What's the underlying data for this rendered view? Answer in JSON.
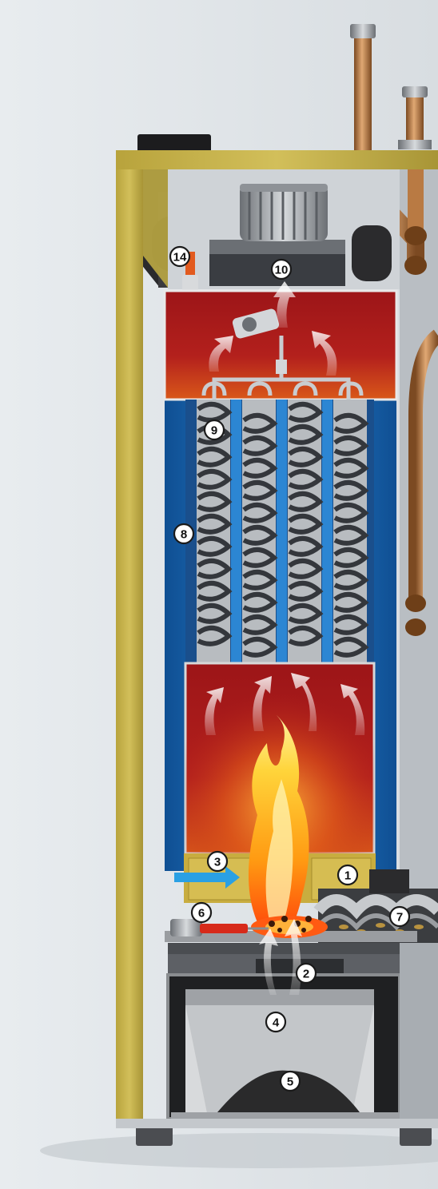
{
  "diagram": {
    "callouts": [
      {
        "id": "c1",
        "label": "1"
      },
      {
        "id": "c2",
        "label": "2"
      },
      {
        "id": "c3",
        "label": "3"
      },
      {
        "id": "c4",
        "label": "4"
      },
      {
        "id": "c5",
        "label": "5"
      },
      {
        "id": "c6",
        "label": "6"
      },
      {
        "id": "c7",
        "label": "7"
      },
      {
        "id": "c8",
        "label": "8"
      },
      {
        "id": "c9",
        "label": "9"
      },
      {
        "id": "c10",
        "label": "10"
      },
      {
        "id": "c14",
        "label": "14"
      }
    ]
  },
  "colors": {
    "background": "#e3e7ea",
    "insulation": "#c6b24a",
    "combustion_chamber": "#a8191c",
    "water_jacket": "#1e6fb8",
    "flame": "#ffb21a",
    "copper_pipe": "#b97a43",
    "steel_spiral": "#3a3d42"
  }
}
